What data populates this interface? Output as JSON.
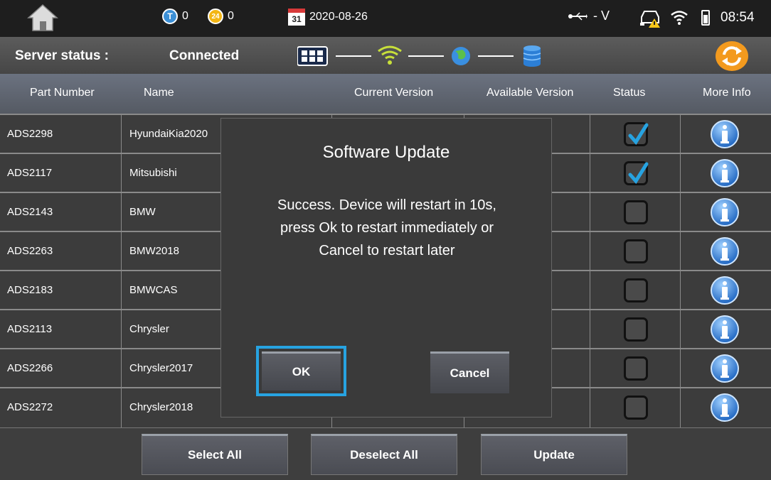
{
  "status_bar": {
    "t_count": "0",
    "t_glyph": "T",
    "a_count": "0",
    "a_glyph": "24",
    "calendar_day": "31",
    "date": "2020-08-26",
    "usb_text": "- V",
    "time": "08:54"
  },
  "server": {
    "label": "Server status :",
    "value": "Connected"
  },
  "table": {
    "headers": {
      "part_number": "Part Number",
      "name": "Name",
      "current_version": "Current Version",
      "available_version": "Available Version",
      "status": "Status",
      "more_info": "More Info"
    },
    "rows": [
      {
        "part": "ADS2298",
        "name": "HyundaiKia2020",
        "checked": true
      },
      {
        "part": "ADS2117",
        "name": "Mitsubishi",
        "checked": true
      },
      {
        "part": "ADS2143",
        "name": "BMW",
        "checked": false
      },
      {
        "part": "ADS2263",
        "name": "BMW2018",
        "checked": false
      },
      {
        "part": "ADS2183",
        "name": "BMWCAS",
        "checked": false
      },
      {
        "part": "ADS2113",
        "name": "Chrysler",
        "checked": false
      },
      {
        "part": "ADS2266",
        "name": "Chrysler2017",
        "checked": false
      },
      {
        "part": "ADS2272",
        "name": "Chrysler2018",
        "checked": false
      }
    ]
  },
  "footer": {
    "select_all": "Select All",
    "deselect_all": "Deselect All",
    "update": "Update"
  },
  "dialog": {
    "title": "Software Update",
    "line1": "Success. Device will restart in 10s,",
    "line2": "press Ok to restart immediately or",
    "line3": "Cancel to restart later",
    "ok": "OK",
    "cancel": "Cancel"
  },
  "colors": {
    "accent": "#27a3e1",
    "check": "#27a3e1",
    "refresh": "#f39a1e"
  }
}
